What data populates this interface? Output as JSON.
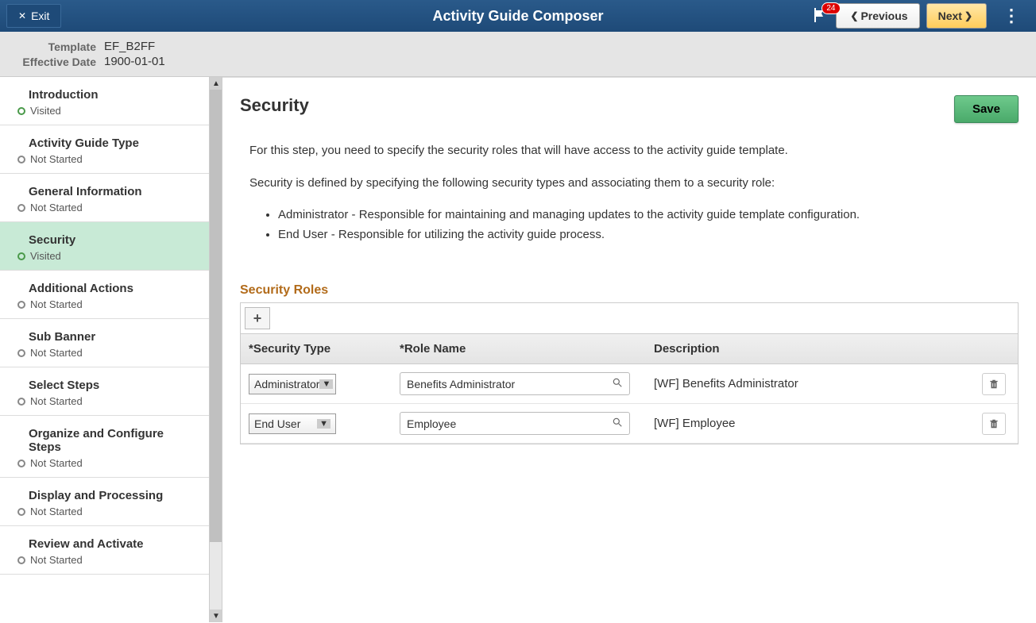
{
  "header": {
    "exit_label": "Exit",
    "title": "Activity Guide Composer",
    "notification_count": "24",
    "previous_label": "Previous",
    "next_label": "Next"
  },
  "info": {
    "template_label": "Template",
    "template_value": "EF_B2FF",
    "effdate_label": "Effective Date",
    "effdate_value": "1900-01-01"
  },
  "sidebar": {
    "items": [
      {
        "label": "Introduction",
        "status": "Visited",
        "visited": true,
        "active": false
      },
      {
        "label": "Activity Guide Type",
        "status": "Not Started",
        "visited": false,
        "active": false
      },
      {
        "label": "General Information",
        "status": "Not Started",
        "visited": false,
        "active": false
      },
      {
        "label": "Security",
        "status": "Visited",
        "visited": true,
        "active": true
      },
      {
        "label": "Additional Actions",
        "status": "Not Started",
        "visited": false,
        "active": false
      },
      {
        "label": "Sub Banner",
        "status": "Not Started",
        "visited": false,
        "active": false
      },
      {
        "label": "Select Steps",
        "status": "Not Started",
        "visited": false,
        "active": false
      },
      {
        "label": "Organize and Configure Steps",
        "status": "Not Started",
        "visited": false,
        "active": false
      },
      {
        "label": "Display and Processing",
        "status": "Not Started",
        "visited": false,
        "active": false
      },
      {
        "label": "Review and Activate",
        "status": "Not Started",
        "visited": false,
        "active": false
      }
    ]
  },
  "main": {
    "title": "Security",
    "save_label": "Save",
    "intro_p1": "For this step, you need to specify the security roles that will have access to the activity guide template.",
    "intro_p2": "Security is defined by specifying the following security types and associating them to a security role:",
    "bullet1": "Administrator - Responsible for maintaining and managing updates to the activity guide template configuration.",
    "bullet2": "End User - Responsible for utilizing the activity guide process.",
    "section_title": "Security Roles",
    "columns": {
      "type": "*Security Type",
      "role": "*Role Name",
      "desc": "Description"
    },
    "rows": [
      {
        "type": "Administrator",
        "role": "Benefits Administrator",
        "desc": "[WF] Benefits Administrator"
      },
      {
        "type": "End User",
        "role": "Employee",
        "desc": "[WF] Employee"
      }
    ]
  }
}
